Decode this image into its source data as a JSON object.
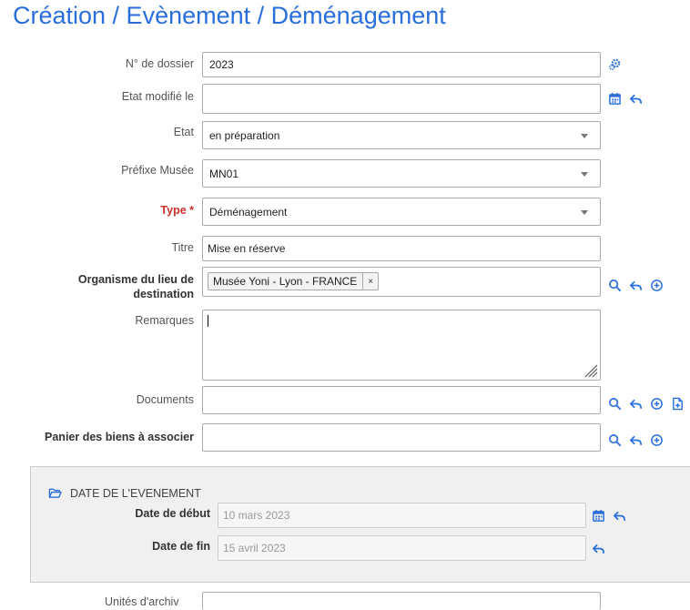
{
  "page": {
    "title": "Création / Evènement / Déménagement"
  },
  "colors": {
    "accent": "#2a6edb",
    "required": "#c9302c",
    "icon": "#2a6edb"
  },
  "form": {
    "dossier": {
      "label": "N° de dossier",
      "value": "2023",
      "icons": [
        "cog-icon"
      ]
    },
    "etat_modifie": {
      "label": "Etat modifié le",
      "value": "",
      "icons": [
        "calendar-icon",
        "undo-icon"
      ]
    },
    "etat": {
      "label": "Etat",
      "value": "en préparation"
    },
    "prefixe": {
      "label": "Préfixe Musée",
      "value": "MN01"
    },
    "type": {
      "label": "Type *",
      "value": "Déménagement"
    },
    "titre": {
      "label": "Titre",
      "value": "Mise en réserve"
    },
    "organisme": {
      "label": "Organisme du lieu de destination",
      "tag": "Musée Yoni - Lyon - FRANCE",
      "tag_remove": "×",
      "icons": [
        "search-icon",
        "undo-icon",
        "add-circle-icon"
      ]
    },
    "remarques": {
      "label": "Remarques",
      "value": ""
    },
    "documents": {
      "label": "Documents",
      "value": "",
      "icons": [
        "search-icon",
        "undo-icon",
        "add-circle-icon",
        "add-file-icon"
      ]
    },
    "panier": {
      "label": "Panier des biens à associer",
      "value": "",
      "icons": [
        "search-icon",
        "undo-icon",
        "add-circle-icon"
      ]
    }
  },
  "event_section": {
    "title": "DATE DE L'EVENEMENT",
    "icon": "folder-open-icon",
    "date_debut": {
      "label": "Date de début",
      "placeholder": "10 mars 2023",
      "icons": [
        "calendar-icon",
        "undo-icon"
      ]
    },
    "date_fin": {
      "label": "Date de fin",
      "placeholder": "15 avril 2023",
      "icons": [
        "undo-icon"
      ]
    }
  },
  "cutoff": {
    "label": "Unités d'archiv"
  }
}
